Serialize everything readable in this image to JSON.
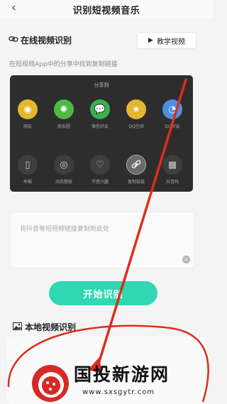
{
  "header": {
    "title": "识别短视频音乐",
    "back_icon": "chevron-left-icon"
  },
  "online": {
    "label": "在线视频识别",
    "tutorial_label": "教学视频",
    "hint": "在短视频App中的分享中找到复制链接"
  },
  "share_panel": {
    "title": "分享到",
    "row1": [
      {
        "label": "朋友",
        "icon": "friends-icon",
        "color": "#e3b72e"
      },
      {
        "label": "朋友圈",
        "icon": "moments-icon",
        "color": "#4dbb3f"
      },
      {
        "label": "微信好友",
        "icon": "wechat-icon",
        "color": "#37b24d"
      },
      {
        "label": "QQ空间",
        "icon": "qzone-icon",
        "color": "#e3b72e"
      },
      {
        "label": "QQ好友",
        "icon": "qq-icon",
        "color": "#4e8fe3"
      }
    ],
    "row2": [
      {
        "label": "举报",
        "icon": "report-icon"
      },
      {
        "label": "动态壁纸",
        "icon": "wallpaper-icon"
      },
      {
        "label": "不感兴趣",
        "icon": "dislike-icon"
      },
      {
        "label": "复制链接",
        "icon": "link-icon"
      },
      {
        "label": "抖音码",
        "icon": "qrcode-icon"
      }
    ]
  },
  "url_input": {
    "placeholder": "将抖音等短视频链接复制到此处"
  },
  "start_button": {
    "label": "开始识别"
  },
  "local": {
    "label": "本地视频识别"
  },
  "colors": {
    "accent": "#2fd8b2",
    "annotation": "#d92f1f"
  },
  "watermark": {
    "title": "国投新游网",
    "url": "www.sxsgytr.com"
  }
}
